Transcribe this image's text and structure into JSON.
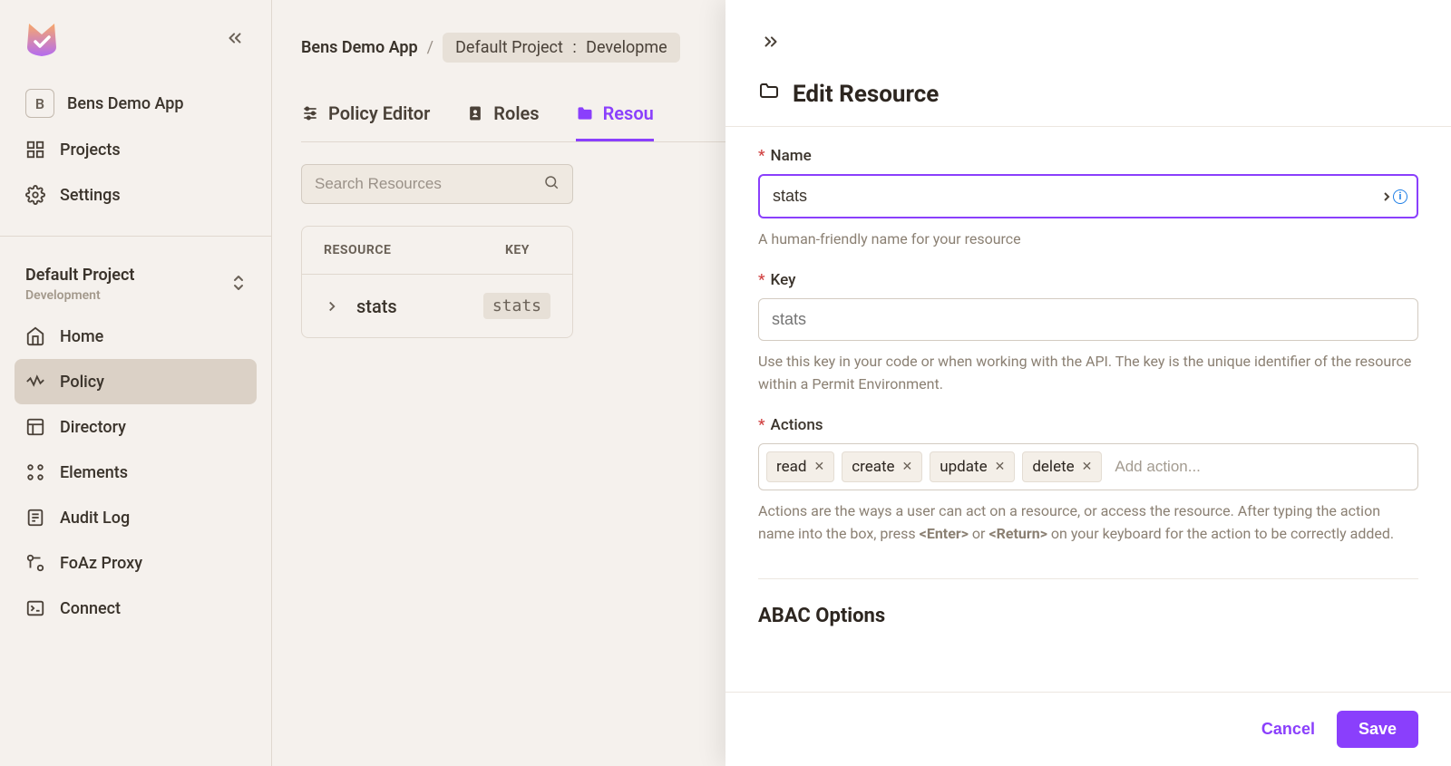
{
  "sidebar": {
    "app_name": "Bens Demo App",
    "app_letter": "B",
    "nav": {
      "projects": "Projects",
      "settings": "Settings",
      "home": "Home",
      "policy": "Policy",
      "directory": "Directory",
      "elements": "Elements",
      "audit_log": "Audit Log",
      "foaz_proxy": "FoAz Proxy",
      "connect": "Connect"
    },
    "project": {
      "name": "Default Project",
      "env": "Development"
    }
  },
  "breadcrumb": {
    "app": "Bens Demo App",
    "sep": "/",
    "project": "Default Project",
    "colon": ":",
    "env": "Developme"
  },
  "tabs": {
    "policy_editor": "Policy Editor",
    "roles": "Roles",
    "resources": "Resou"
  },
  "search": {
    "placeholder": "Search Resources"
  },
  "table": {
    "headers": {
      "resource": "RESOURCE",
      "key": "KEY"
    },
    "rows": [
      {
        "name": "stats",
        "key": "stats"
      }
    ]
  },
  "drawer": {
    "title": "Edit Resource",
    "name": {
      "label": "Name",
      "value": "stats",
      "help": "A human-friendly name for your resource"
    },
    "key": {
      "label": "Key",
      "placeholder": "stats",
      "help": "Use this key in your code or when working with the API. The key is the unique identifier of the resource within a Permit Environment."
    },
    "actions": {
      "label": "Actions",
      "items": [
        "read",
        "create",
        "update",
        "delete"
      ],
      "placeholder": "Add action...",
      "help_pre": "Actions are the ways a user can act on a resource, or access the resource. After typing the action name into the box, press ",
      "help_enter": "<Enter>",
      "help_or": " or ",
      "help_return": "<Return>",
      "help_post": " on your keyboard for the action to be correctly added."
    },
    "abac_heading": "ABAC Options",
    "footer": {
      "cancel": "Cancel",
      "save": "Save"
    }
  }
}
